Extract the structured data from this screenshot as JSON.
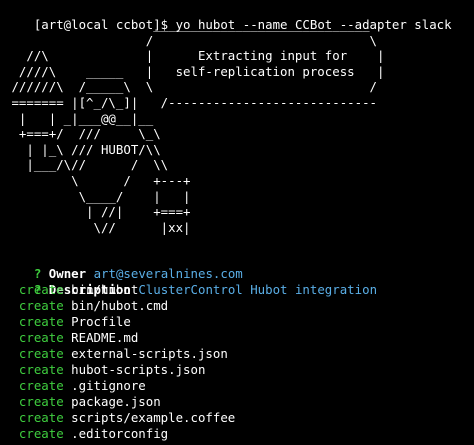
{
  "terminal": {
    "prompt": "[art@local ccbot]$ ",
    "command": "yo hubot --name CCBot --adapter slack"
  },
  "banner": {
    "art_lines": [
      "                    _____________________________",
      "                   /                             \\",
      "   //\\             |      Extracting input for    |",
      "  ////\\    _____   |   self-replication process   |",
      " //////\\  /_____\\  \\                             /",
      " ======= |[^_/\\_]|   /----------------------------",
      "  |   | _|___@@__|__",
      "  +===+/  ///     \\_\\",
      "   | |_\\ /// HUBOT/\\\\",
      "   |___/\\//      /  \\\\",
      "         \\      /   +---+",
      "          \\____/    |   |",
      "           | //|    +===+",
      "            \\//      |xx|"
    ]
  },
  "answers": [
    {
      "symbol": "?",
      "label": "Owner",
      "value": "art@severalnines.com"
    },
    {
      "symbol": "?",
      "label": "Description",
      "value": "ClusterControl Hubot integration"
    }
  ],
  "actions": [
    {
      "verb": "create",
      "path": "bin/hubot"
    },
    {
      "verb": "create",
      "path": "bin/hubot.cmd"
    },
    {
      "verb": "create",
      "path": "Procfile"
    },
    {
      "verb": "create",
      "path": "README.md"
    },
    {
      "verb": "create",
      "path": "external-scripts.json"
    },
    {
      "verb": "create",
      "path": "hubot-scripts.json"
    },
    {
      "verb": "create",
      "path": ".gitignore"
    },
    {
      "verb": "create",
      "path": "package.json"
    },
    {
      "verb": "create",
      "path": "scripts/example.coffee"
    },
    {
      "verb": "create",
      "path": ".editorconfig"
    }
  ],
  "colors": {
    "background": "#000000",
    "question_mark": "#3fce3f",
    "create_verb": "#3fce3f",
    "answer_value": "#5aaee6",
    "text": "#ffffff"
  }
}
